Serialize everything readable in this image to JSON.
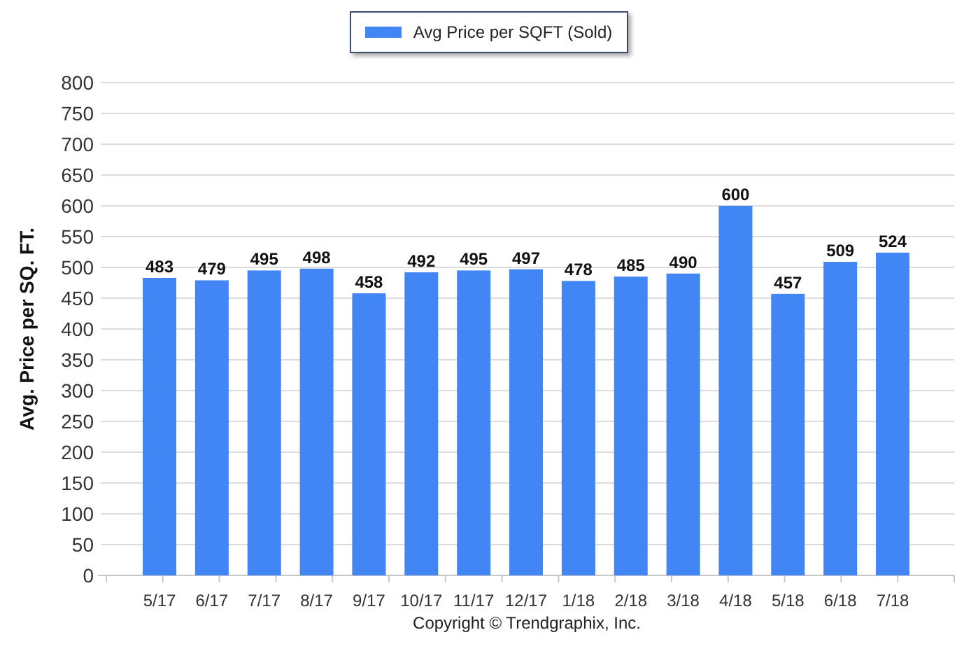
{
  "chart_data": {
    "type": "bar",
    "grid": true,
    "ylabel": "Avg. Price per SQ. FT.",
    "categories": [
      "5/17",
      "6/17",
      "7/17",
      "8/17",
      "9/17",
      "10/17",
      "11/17",
      "12/17",
      "1/18",
      "2/18",
      "3/18",
      "4/18",
      "5/18",
      "6/18",
      "7/18"
    ],
    "series": [
      {
        "name": "Avg Price per SQFT (Sold)",
        "color": "#4285f4",
        "values": [
          483,
          479,
          495,
          498,
          458,
          492,
          495,
          497,
          478,
          485,
          490,
          600,
          457,
          509,
          524
        ]
      }
    ],
    "ylim": [
      0,
      800
    ],
    "yticks": [
      0,
      50,
      100,
      150,
      200,
      250,
      300,
      350,
      400,
      450,
      500,
      550,
      600,
      650,
      700,
      750,
      800
    ],
    "data_labels": true
  },
  "footer": "Copyright © Trendgraphix, Inc."
}
